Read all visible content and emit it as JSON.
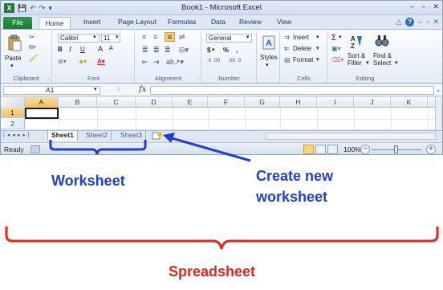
{
  "window": {
    "title": "Book1 - Microsoft Excel",
    "logo_text": "X",
    "controls": [
      "–",
      "▫",
      "✕"
    ]
  },
  "qat": [
    "💾",
    "↶",
    "↷",
    "▾"
  ],
  "ribbon_tabs": [
    "File",
    "Home",
    "Insert",
    "Page Layout",
    "Formulas",
    "Data",
    "Review",
    "View"
  ],
  "active_tab": "Home",
  "ribbon": {
    "clipboard": {
      "label": "Clipboard",
      "paste": "Paste"
    },
    "font": {
      "label": "Font",
      "name": "Calibri",
      "size": "11",
      "bold": "B",
      "italic": "I",
      "underline": "U",
      "grow": "A",
      "shrink": "A"
    },
    "alignment": {
      "label": "Alignment"
    },
    "number": {
      "label": "Number",
      "format": "General",
      "currency": "$",
      "percent": "%",
      "comma": ",",
      "inc_decimal": ".0 .00",
      "dec_decimal": ".00 .0"
    },
    "styles": {
      "label": "Styles"
    },
    "cells": {
      "label": "Cells",
      "insert": "Insert",
      "delete": "Delete",
      "format": "Format"
    },
    "editing": {
      "label": "Editing",
      "sum": "Σ",
      "sort": "Sort &",
      "filter": "Filter",
      "find": "Find &",
      "select": "Select"
    }
  },
  "formula_bar": {
    "name_box": "A1",
    "fx": "fx",
    "value": ""
  },
  "grid": {
    "columns": [
      "A",
      "B",
      "C",
      "D",
      "E",
      "F",
      "G",
      "H",
      "I",
      "J",
      "K"
    ],
    "rows": [
      "1",
      "2"
    ],
    "selected_column": "A",
    "selected_row": "1"
  },
  "sheet_tabs": [
    "Sheet1",
    "Sheet2",
    "Sheet3"
  ],
  "active_sheet": "Sheet1",
  "status": {
    "text": "Ready",
    "zoom": "100%",
    "zoom_minus": "−",
    "zoom_plus": "+",
    "zoom_level": 1.0
  },
  "annotations": {
    "worksheet": "Worksheet",
    "create_new_1": "Create new",
    "create_new_2": "worksheet",
    "spreadsheet": "Spreadsheet"
  },
  "colors": {
    "blue": "#1f3fd6",
    "red": "#e3261f",
    "excel_green": "#1f7a3a"
  }
}
